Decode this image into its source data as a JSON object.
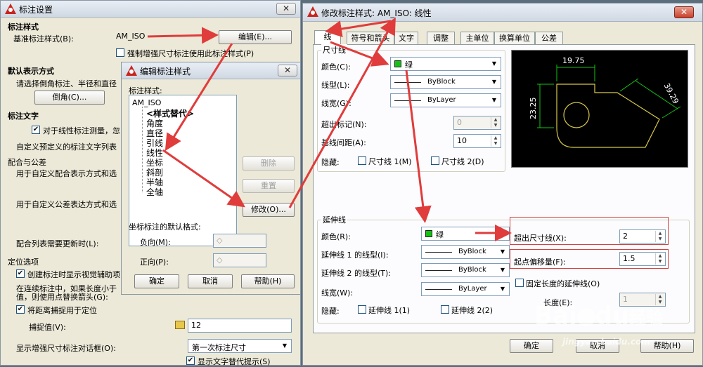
{
  "win1": {
    "title": "标注设置",
    "sec_style": "标注样式",
    "base_label": "基准标注样式(B):",
    "base_value": "AM_ISO",
    "edit_btn": "编辑(E)...",
    "force_chk": "强制增强尺寸标注使用此标注样式(P)",
    "sec_default": "默认表示方式",
    "default_desc": "请选择倒角标注、半径和直径",
    "chamfer_btn": "倒角(C)...",
    "sec_text": "标注文字",
    "text_chk": "对于线性标注测量，忽",
    "text_desc": "自定义预定义的标注文字列表",
    "sec_fit": "配合与公差",
    "fit_desc1": "用于自定义配合表示方式和选",
    "fit_desc2": "用于自定义公差表达方式和选",
    "fit_update": "配合列表需要更新时(L):",
    "sec_locate": "定位选项",
    "locate_chk1": "创建标注时显示视觉辅助项",
    "locate_desc1": "在连续标注中，如果长度小于",
    "locate_desc2": "值，则使用点替换箭头(G):",
    "locate_chk2": "将距离捕捉用于定位",
    "snap_label": "捕捉值(V):",
    "snap_value": "12",
    "enhanced_label": "显示增强尺寸标注对话框(O):",
    "enhanced_value": "第一次标注尺寸",
    "show_alt_chk": "显示文字替代提示(S)"
  },
  "win2": {
    "title": "编辑标注样式",
    "list_label": "标注样式:",
    "root": "AM_ISO",
    "items": [
      "<样式替代>",
      "角度",
      "直径",
      "引线",
      "线性",
      "坐标",
      "斜剖",
      "半轴",
      "全轴"
    ],
    "delete_btn": "删除",
    "reset_btn": "重置",
    "modify_btn": "修改(O)...",
    "coord_label": "坐标标注的默认格式:",
    "neg_label": "负向(M):",
    "neg_value": "◇",
    "pos_label": "正向(P):",
    "pos_value": "◇",
    "ok": "确定",
    "cancel": "取消",
    "help": "帮助(H)"
  },
  "win3": {
    "title": "修改标注样式: AM_ISO: 线性",
    "tabs": [
      "线",
      "符号和箭头",
      "文字",
      "调整",
      "主单位",
      "换算单位",
      "公差"
    ],
    "dim_group": "尺寸线",
    "color_label": "颜色(C):",
    "color_value": "绿",
    "ltype_label": "线型(L):",
    "ltype_value": "ByBlock",
    "lweight_label": "线宽(G):",
    "lweight_value": "ByLayer",
    "ext_mark_label": "超出标记(N):",
    "ext_mark_value": "0",
    "baseline_label": "基线间距(A):",
    "baseline_value": "10",
    "hide_label": "隐藏:",
    "hide1": "尺寸线 1(M)",
    "hide2": "尺寸线 2(D)",
    "ext_group": "延伸线",
    "ext_color_label": "颜色(R):",
    "ext_color_value": "绿",
    "ext_lt1_label": "延伸线 1 的线型(I):",
    "ext_lt1_value": "ByBlock",
    "ext_lt2_label": "延伸线 2 的线型(T):",
    "ext_lt2_value": "ByBlock",
    "ext_lw_label": "线宽(W):",
    "ext_lw_value": "ByLayer",
    "ext_hide_label": "隐藏:",
    "ext_hide1": "延伸线 1(1)",
    "ext_hide2": "延伸线 2(2)",
    "beyond_label": "超出尺寸线(X):",
    "beyond_value": "2",
    "offset_label": "起点偏移量(F):",
    "offset_value": "1.5",
    "fixed_chk": "固定长度的延伸线(O)",
    "length_label": "长度(E):",
    "length_value": "1",
    "ok": "确定",
    "cancel": "取消",
    "help": "帮助(H)",
    "preview": {
      "d1": "19.75",
      "d2": "23.25",
      "d3": "39.29"
    }
  },
  "watermark": {
    "brand": "Bai",
    "paw": "du",
    "sub": "经验",
    "url": "jingyan.baidu.com"
  },
  "colors": {
    "annotation_red": "#e03c3c",
    "preview_green": "#14c214",
    "preview_yellow": "#d7c84a"
  }
}
